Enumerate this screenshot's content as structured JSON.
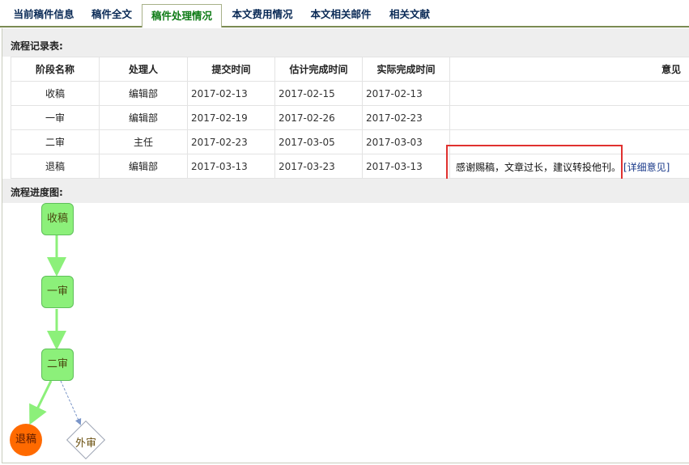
{
  "tabs": [
    {
      "label": "当前稿件信息",
      "active": false
    },
    {
      "label": "稿件全文",
      "active": false
    },
    {
      "label": "稿件处理情况",
      "active": true
    },
    {
      "label": "本文费用情况",
      "active": false
    },
    {
      "label": "本文相关邮件",
      "active": false
    },
    {
      "label": "相关文献",
      "active": false
    }
  ],
  "records": {
    "title": "流程记录表:",
    "headers": [
      "阶段名称",
      "处理人",
      "提交时间",
      "估计完成时间",
      "实际完成时间",
      "意见"
    ],
    "rows": [
      {
        "stage": "收稿",
        "handler": "编辑部",
        "submitted": "2017-02-13",
        "estimated": "2017-02-15",
        "actual": "2017-02-13",
        "opinion": ""
      },
      {
        "stage": "一审",
        "handler": "编辑部",
        "submitted": "2017-02-19",
        "estimated": "2017-02-26",
        "actual": "2017-02-23",
        "opinion": ""
      },
      {
        "stage": "二审",
        "handler": "主任",
        "submitted": "2017-02-23",
        "estimated": "2017-03-05",
        "actual": "2017-03-03",
        "opinion": ""
      },
      {
        "stage": "退稿",
        "handler": "编辑部",
        "submitted": "2017-03-13",
        "estimated": "2017-03-23",
        "actual": "2017-03-13",
        "opinion": "感谢赐稿，文章过长，建议转投他刊。",
        "detail_link": "[详细意见]"
      }
    ]
  },
  "flow": {
    "title": "流程进度图:",
    "nodes": [
      {
        "label": "收稿",
        "shape": "rounded-box",
        "color": "#8cf07a"
      },
      {
        "label": "一审",
        "shape": "rounded-box",
        "color": "#8cf07a"
      },
      {
        "label": "二审",
        "shape": "rounded-box",
        "color": "#8cf07a"
      },
      {
        "label": "退稿",
        "shape": "circle",
        "color": "#ff6a00"
      },
      {
        "label": "外审",
        "shape": "diamond",
        "color": "#ffffff"
      }
    ],
    "edge_color": "#8cf07a",
    "alt_edge_color": "#7a95c8"
  },
  "colors": {
    "active_tab_text": "#0e7b16",
    "tab_text": "#0a2a56",
    "highlight": "#e0312f"
  }
}
